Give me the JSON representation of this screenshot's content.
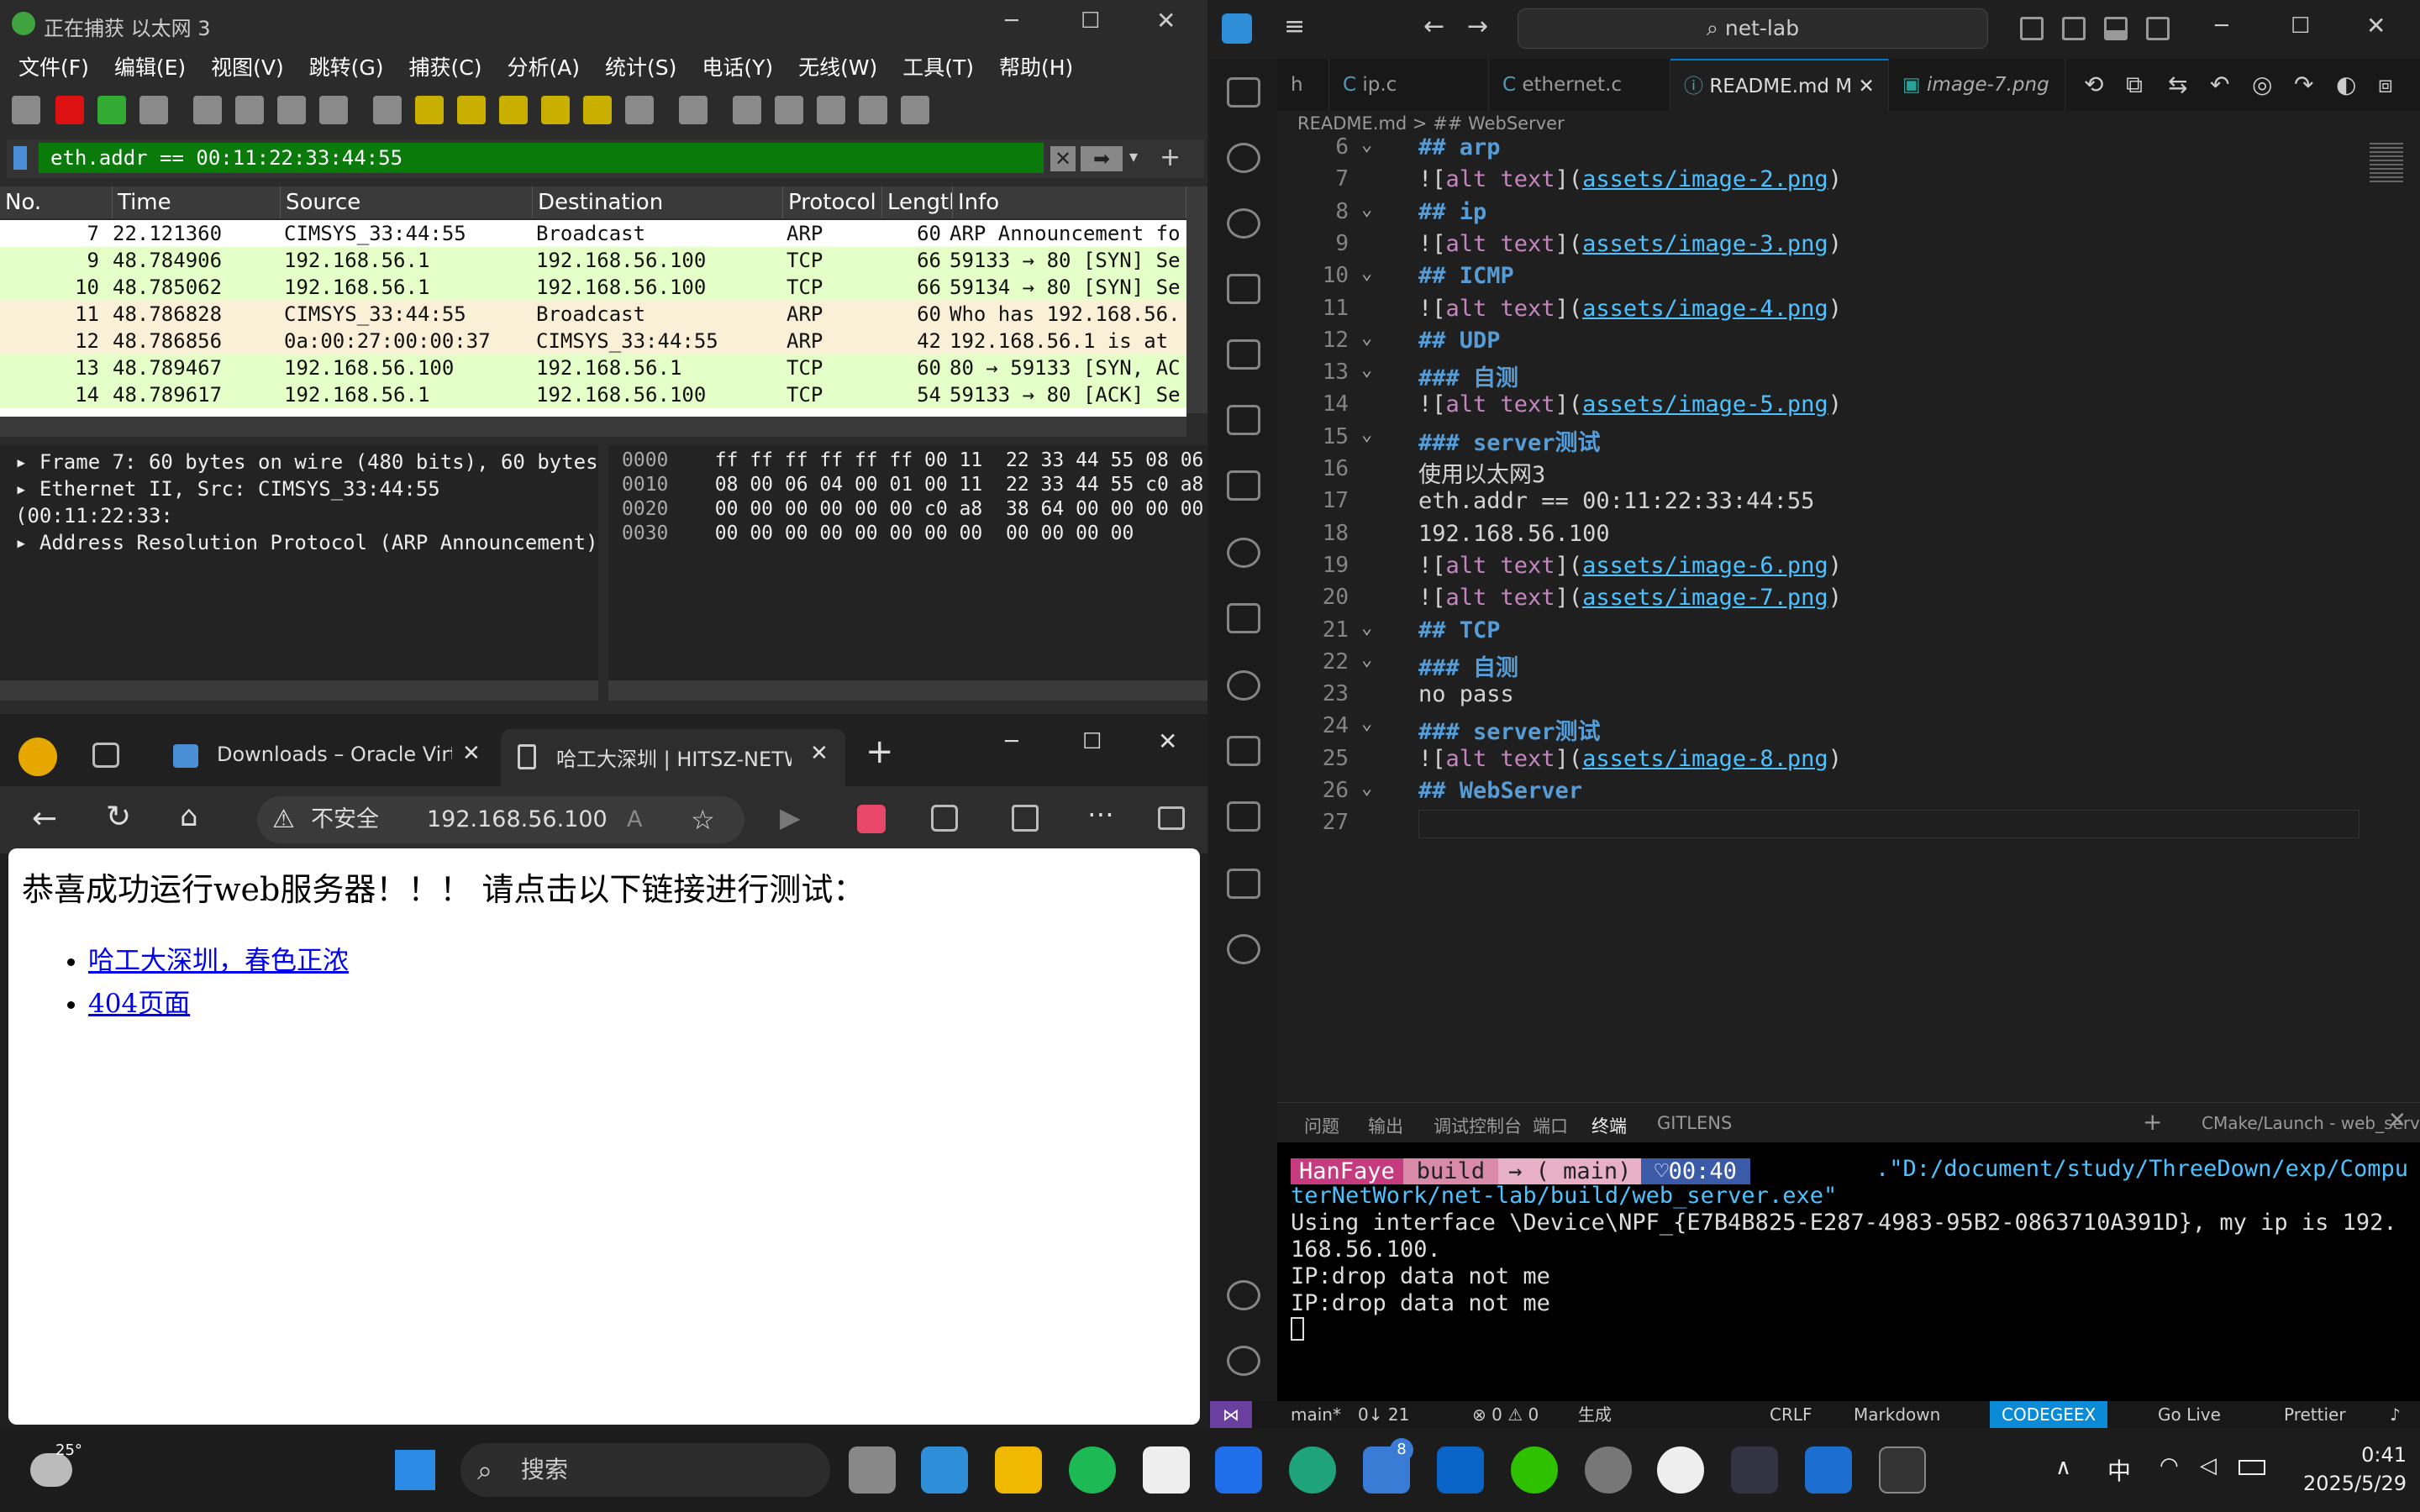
{
  "wireshark": {
    "title": "正在捕获 以太网 3",
    "menu": [
      "文件(F)",
      "编辑(E)",
      "视图(V)",
      "跳转(G)",
      "捕获(C)",
      "分析(A)",
      "统计(S)",
      "电话(Y)",
      "无线(W)",
      "工具(T)",
      "帮助(H)"
    ],
    "filter": "eth.addr == 00:11:22:33:44:55",
    "columns": [
      "No.",
      "Time",
      "Source",
      "Destination",
      "Protocol",
      "Length",
      "Info"
    ],
    "packets": [
      {
        "no": "7",
        "time": "22.121360",
        "src": "CIMSYS_33:44:55",
        "dst": "Broadcast",
        "proto": "ARP",
        "len": "60",
        "info": "ARP Announcement fo",
        "bg": "#ffffff",
        "selected": true
      },
      {
        "no": "9",
        "time": "48.784906",
        "src": "192.168.56.1",
        "dst": "192.168.56.100",
        "proto": "TCP",
        "len": "66",
        "info": "59133 → 80 [SYN] Se",
        "bg": "#e4ffc7"
      },
      {
        "no": "10",
        "time": "48.785062",
        "src": "192.168.56.1",
        "dst": "192.168.56.100",
        "proto": "TCP",
        "len": "66",
        "info": "59134 → 80 [SYN] Se",
        "bg": "#e4ffc7"
      },
      {
        "no": "11",
        "time": "48.786828",
        "src": "CIMSYS_33:44:55",
        "dst": "Broadcast",
        "proto": "ARP",
        "len": "60",
        "info": "Who has 192.168.56.",
        "bg": "#faf0d7"
      },
      {
        "no": "12",
        "time": "48.786856",
        "src": "0a:00:27:00:00:37",
        "dst": "CIMSYS_33:44:55",
        "proto": "ARP",
        "len": "42",
        "info": "192.168.56.1 is at",
        "bg": "#faf0d7"
      },
      {
        "no": "13",
        "time": "48.789467",
        "src": "192.168.56.100",
        "dst": "192.168.56.1",
        "proto": "TCP",
        "len": "60",
        "info": "80 → 59133 [SYN, AC",
        "bg": "#e4ffc7"
      },
      {
        "no": "14",
        "time": "48.789617",
        "src": "192.168.56.1",
        "dst": "192.168.56.100",
        "proto": "TCP",
        "len": "54",
        "info": "59133 → 80 [ACK] Se",
        "bg": "#e4ffc7"
      }
    ],
    "details": [
      "Frame 7: 60 bytes on wire (480 bits), 60 bytes",
      "Ethernet II, Src: CIMSYS_33:44:55 (00:11:22:33:",
      "Address Resolution Protocol (ARP Announcement)"
    ],
    "hex": [
      {
        "off": "0000",
        "a": "ff ff ff ff ff ff 00 11",
        "b": "22 33 44 55 08 06"
      },
      {
        "off": "0010",
        "a": "08 00 06 04 00 01 00 11",
        "b": "22 33 44 55 c0 a8"
      },
      {
        "off": "0020",
        "a": "00 00 00 00 00 00 c0 a8",
        "b": "38 64 00 00 00 00"
      },
      {
        "off": "0030",
        "a": "00 00 00 00 00 00 00 00",
        "b": "00 00 00 00"
      }
    ]
  },
  "browser": {
    "tabs": [
      "Downloads – Oracle Virtua",
      "哈工大深圳 | HITSZ-NETW"
    ],
    "insecure": "不安全",
    "url": "192.168.56.100",
    "heading": "恭喜成功运行web服务器！！！ 请点击以下链接进行测试：",
    "links": [
      "哈工大深圳，春色正浓",
      "404页面"
    ]
  },
  "vscode": {
    "search": "net-lab",
    "tabs": [
      "h",
      "ip.c",
      "ethernet.c",
      "README.md M",
      "image-7.png"
    ],
    "breadcrumb": "README.md > ## WebServer",
    "lines": [
      {
        "n": "6",
        "t": "## arp",
        "k": "h"
      },
      {
        "n": "7",
        "t": "![alt text](assets/image-2.png)",
        "k": "img",
        "p": "assets/image-2.png"
      },
      {
        "n": "8",
        "t": "## ip",
        "k": "h"
      },
      {
        "n": "9",
        "t": "![alt text](assets/image-3.png)",
        "k": "img",
        "p": "assets/image-3.png"
      },
      {
        "n": "10",
        "t": "## ICMP",
        "k": "h"
      },
      {
        "n": "11",
        "t": "![alt text](assets/image-4.png)",
        "k": "img",
        "p": "assets/image-4.png"
      },
      {
        "n": "12",
        "t": "## UDP",
        "k": "h"
      },
      {
        "n": "13",
        "t": "### 自测",
        "k": "h"
      },
      {
        "n": "14",
        "t": "![alt text](assets/image-5.png)",
        "k": "img",
        "p": "assets/image-5.png"
      },
      {
        "n": "15",
        "t": "### server测试",
        "k": "h"
      },
      {
        "n": "16",
        "t": "使用以太网3",
        "k": "t"
      },
      {
        "n": "17",
        "t": "eth.addr == 00:11:22:33:44:55",
        "k": "t"
      },
      {
        "n": "18",
        "t": "192.168.56.100",
        "k": "t"
      },
      {
        "n": "19",
        "t": "![alt text](assets/image-6.png)",
        "k": "img",
        "p": "assets/image-6.png"
      },
      {
        "n": "20",
        "t": "![alt text](assets/image-7.png)",
        "k": "img",
        "p": "assets/image-7.png"
      },
      {
        "n": "21",
        "t": "## TCP",
        "k": "h"
      },
      {
        "n": "22",
        "t": "### 自测",
        "k": "h"
      },
      {
        "n": "23",
        "t": "no pass",
        "k": "t"
      },
      {
        "n": "24",
        "t": "### server测试",
        "k": "h"
      },
      {
        "n": "25",
        "t": "![alt text](assets/image-8.png)",
        "k": "img",
        "p": "assets/image-8.png"
      },
      {
        "n": "26",
        "t": "## WebServer",
        "k": "h"
      },
      {
        "n": "27",
        "t": "",
        "k": "t"
      }
    ],
    "panel_tabs": [
      "问题",
      "输出",
      "调试控制台",
      "端口",
      "终端",
      "GITLENS"
    ],
    "panel_task": "CMake/Launch - web_server - build",
    "prompt": {
      "user": "HanFaye",
      "dir": "build",
      "branch": "→ ( main)",
      "time": "♡00:40"
    },
    "terminal": [
      ".\"D:/document/study/ThreeDown/exp/Compu",
      "terNetWork/net-lab/build/web_server.exe\"",
      "Using interface \\Device\\NPF_{E7B4B825-E287-4983-95B2-0863710A391D}, my ip is 192.",
      "168.56.100.",
      "IP:drop data not me",
      "IP:drop data not me"
    ],
    "status": {
      "branch": "main*",
      "sync": "0↓ 21",
      "errors": "⊗ 0 ⚠ 0",
      "build": "生成",
      "eol": "CRLF",
      "lang": "Markdown",
      "codegeex": "CODEGEEX",
      "golive": "Go Live",
      "prettier": "Prettier"
    }
  },
  "taskbar": {
    "weather": "25°",
    "search": "搜索",
    "badge": "8",
    "ime": "中",
    "time": "0:41",
    "date": "2025/5/29"
  },
  "colors": {
    "ws_filter": "#0a7a0a",
    "tcp_row": "#e4ffc7",
    "arp_row": "#faf0d7",
    "vs_accent": "#007acc",
    "link": "#0000ee"
  }
}
